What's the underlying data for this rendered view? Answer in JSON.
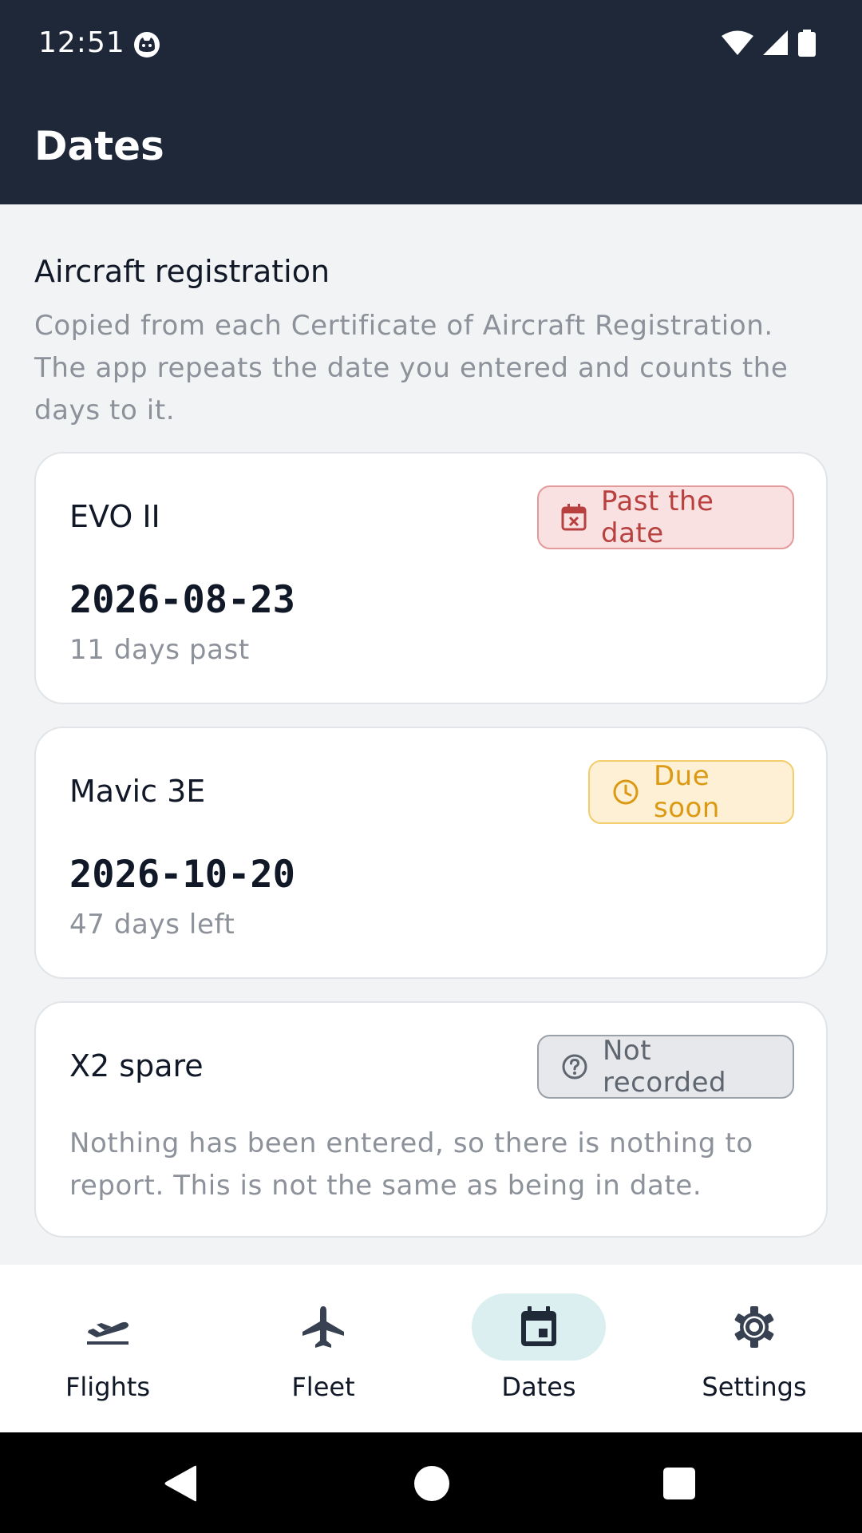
{
  "status_bar": {
    "time": "12:51"
  },
  "app_bar": {
    "title": "Dates"
  },
  "section": {
    "title": "Aircraft registration",
    "description": "Copied from each Certificate of Aircraft Registration. The app repeats the date you entered and counts the days to it."
  },
  "cards": [
    {
      "name": "EVO II",
      "badge": "Past the date",
      "badge_icon": "calendar-x-icon",
      "date": "2026-08-23",
      "detail": "11 days past"
    },
    {
      "name": "Mavic 3E",
      "badge": "Due soon",
      "badge_icon": "clock-icon",
      "date": "2026-10-20",
      "detail": "47 days left"
    },
    {
      "name": "X2 spare",
      "badge": "Not recorded",
      "badge_icon": "question-circle-icon",
      "note": "Nothing has been entered, so there is nothing to report. This is not the same as being in date."
    }
  ],
  "colors": {
    "header_bg": "#1e2838",
    "past": "#b8403f",
    "due_soon": "#dc9a14",
    "not_recorded": "#5f6670",
    "active_nav": "#dbeff0"
  },
  "bottom_nav": {
    "active": "Dates",
    "items": [
      {
        "label": "Flights",
        "icon": "flight-takeoff-icon"
      },
      {
        "label": "Fleet",
        "icon": "airplane-icon"
      },
      {
        "label": "Dates",
        "icon": "calendar-icon"
      },
      {
        "label": "Settings",
        "icon": "gear-icon"
      }
    ]
  }
}
